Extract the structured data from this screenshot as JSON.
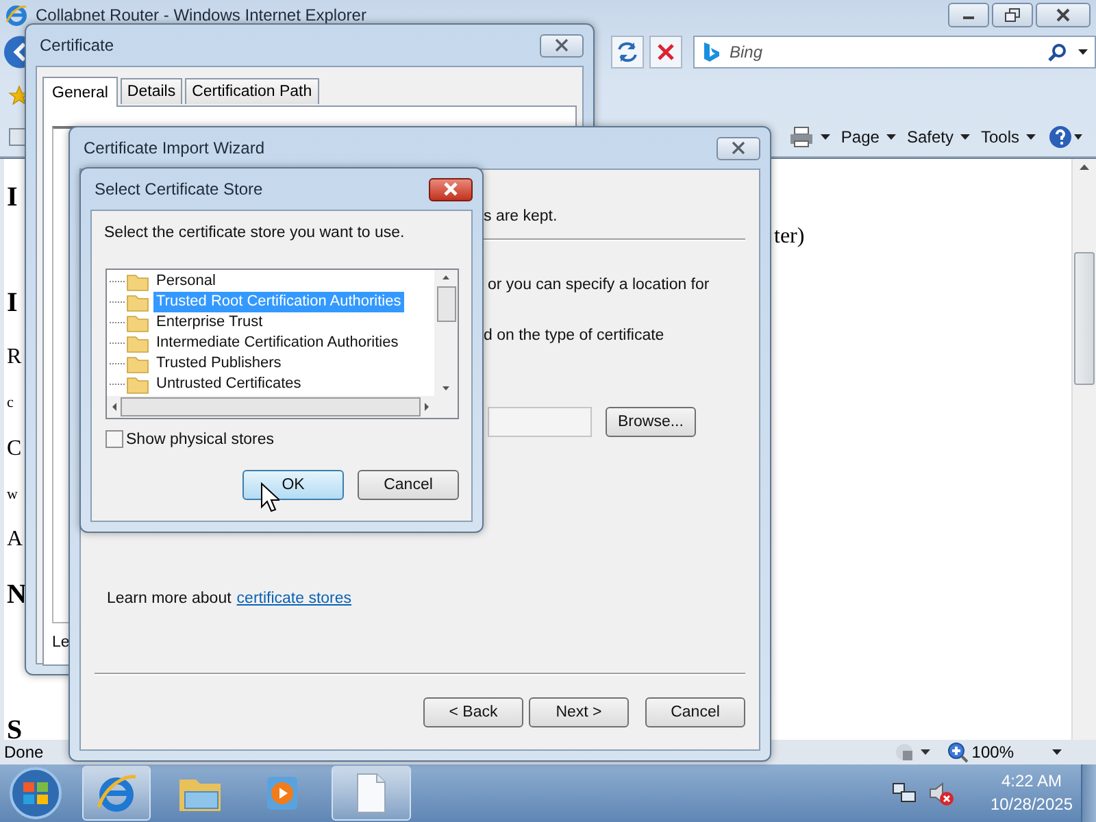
{
  "browser": {
    "title": "Collabnet Router - Windows Internet Explorer",
    "search": {
      "placeholder": "Bing"
    },
    "commands": [
      {
        "label": "Page"
      },
      {
        "label": "Safety"
      },
      {
        "label": "Tools"
      }
    ],
    "page_fragments": [
      {
        "text": "I",
        "kind": "heading"
      },
      {
        "text": "I",
        "kind": "heading"
      },
      {
        "text": "R",
        "kind": "text"
      },
      {
        "text": "c",
        "kind": "small"
      },
      {
        "text": "C",
        "kind": "text"
      },
      {
        "text": "w",
        "kind": "small"
      },
      {
        "text": "A",
        "kind": "text"
      },
      {
        "text": "N",
        "kind": "heading"
      },
      {
        "text": "S",
        "kind": "heading"
      }
    ],
    "page_right_fragment": "ter)",
    "status": "Done",
    "zoom": "100%"
  },
  "certificate_dialog": {
    "title": "Certificate",
    "tabs": [
      {
        "label": "General",
        "selected": true
      },
      {
        "label": "Details",
        "selected": false
      },
      {
        "label": "Certification Path",
        "selected": false
      }
    ],
    "text_fragment": "Le"
  },
  "import_wizard": {
    "title": "Certificate Import Wizard",
    "fragments": [
      "s are kept.",
      "or you can specify a location for",
      "d on the type of certificate"
    ],
    "browse_button": "Browse...",
    "learn_more": "Learn more about",
    "learn_more_link": "certificate stores",
    "buttons": [
      "< Back",
      "Next >",
      "Cancel"
    ]
  },
  "store_dialog": {
    "title": "Select Certificate Store",
    "prompt": "Select the certificate store you want to use.",
    "stores": [
      {
        "label": "Personal",
        "selected": false
      },
      {
        "label": "Trusted Root Certification Authorities",
        "selected": true
      },
      {
        "label": "Enterprise Trust",
        "selected": false
      },
      {
        "label": "Intermediate Certification Authorities",
        "selected": false
      },
      {
        "label": "Trusted Publishers",
        "selected": false
      },
      {
        "label": "Untrusted Certificates",
        "selected": false
      }
    ],
    "show_physical": {
      "label": "Show physical stores",
      "checked": false
    },
    "buttons": [
      {
        "label": "OK",
        "default": true
      },
      {
        "label": "Cancel",
        "default": false
      }
    ]
  },
  "taskbar": {
    "time": "4:22 AM",
    "date": "10/28/2025"
  }
}
